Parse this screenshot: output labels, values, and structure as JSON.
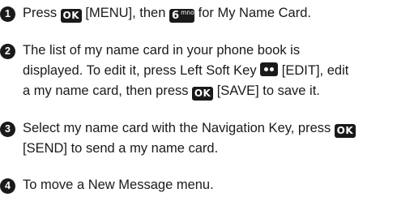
{
  "steps": [
    {
      "number": "1",
      "t1": "Press",
      "ok_key": "OK",
      "t2": "[MENU], then",
      "six_key": "6",
      "six_sup": "mno",
      "t3": "for My Name Card."
    },
    {
      "number": "2",
      "l1": "The list of my name card in your phone book is",
      "l2a": "displayed. To edit it, press Left Soft Key",
      "l2b": "[EDIT], edit",
      "l3a": "a my name card, then press",
      "ok_key": "OK",
      "l3b": "[SAVE] to save it."
    },
    {
      "number": "3",
      "l1a": "Select my name card with the Navigation Key, press",
      "ok_key": "OK",
      "l2": "[SEND] to send a my name card."
    },
    {
      "number": "4",
      "l1": "To move a New Message menu."
    }
  ],
  "icons": {
    "ok": "ok-key-icon",
    "six": "six-mno-key-icon",
    "soft": "left-soft-key-icon"
  }
}
